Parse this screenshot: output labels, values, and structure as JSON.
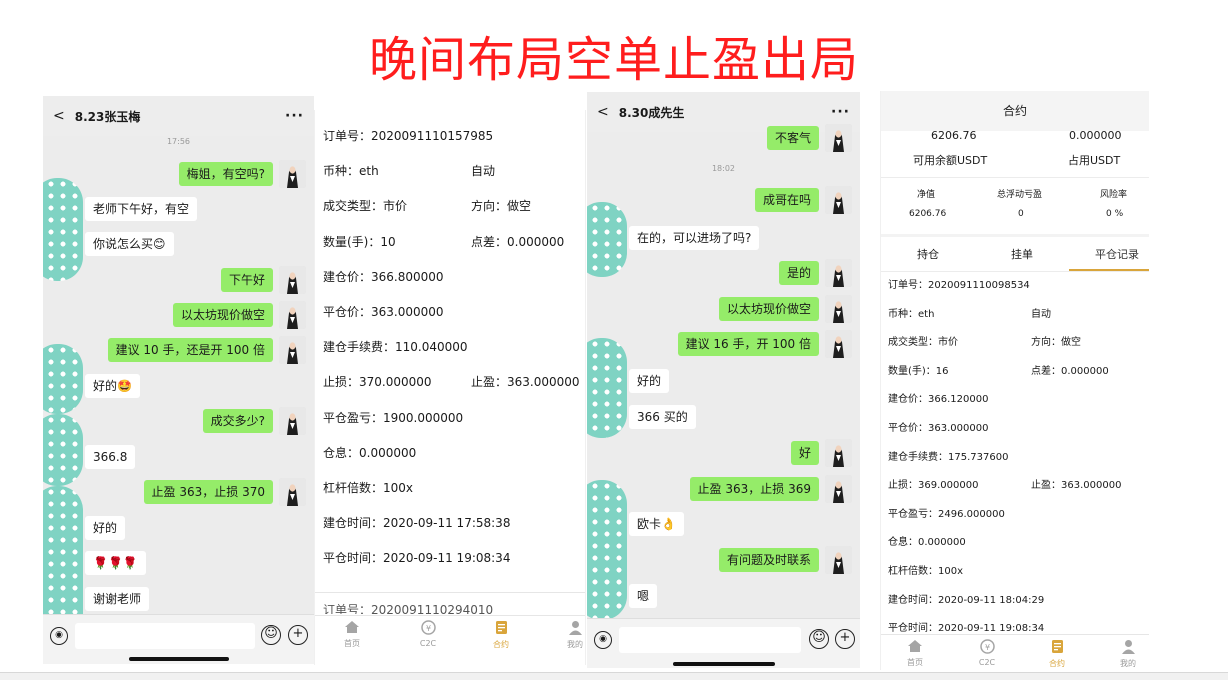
{
  "page_title": "晚间布局空单止盈出局",
  "chat1": {
    "header": {
      "back": "<",
      "name": "8.23张玉梅",
      "more": "···"
    },
    "timestamp": "17:56",
    "messages": [
      {
        "side": "right",
        "text": "梅姐，有空吗?"
      },
      {
        "side": "left",
        "text": "老师下午好，有空"
      },
      {
        "side": "left",
        "text": "你说怎么买😊"
      },
      {
        "side": "right",
        "text": "下午好"
      },
      {
        "side": "right",
        "text": "以太坊现价做空"
      },
      {
        "side": "right",
        "text": "建议 10 手，还是开 100 倍"
      },
      {
        "side": "left",
        "text": "好的🤩"
      },
      {
        "side": "right",
        "text": "成交多少?"
      },
      {
        "side": "left",
        "text": "366.8"
      },
      {
        "side": "right",
        "text": "止盈 363，止损 370"
      },
      {
        "side": "left",
        "text": "好的"
      },
      {
        "side": "left",
        "text": "🌹🌹🌹"
      },
      {
        "side": "left",
        "text": "谢谢老师"
      }
    ]
  },
  "order1": {
    "rows": [
      {
        "l": "订单号：2020091110157985",
        "r": ""
      },
      {
        "l": "币种：eth",
        "r": "自动"
      },
      {
        "l": "成交类型：市价",
        "r": "方向：做空"
      },
      {
        "l": "数量(手)：10",
        "r": "点差：0.000000"
      },
      {
        "l": "建仓价：366.800000",
        "r": ""
      },
      {
        "l": "平仓价：363.000000",
        "r": ""
      },
      {
        "l": "建仓手续费：110.040000",
        "r": ""
      },
      {
        "l": "止损：370.000000",
        "r": "止盈：363.000000"
      },
      {
        "l": "平仓盈亏：1900.000000",
        "r": ""
      },
      {
        "l": "仓息：0.000000",
        "r": ""
      },
      {
        "l": "杠杆倍数：100x",
        "r": ""
      },
      {
        "l": "建仓时间：2020-09-11 17:58:38",
        "r": ""
      },
      {
        "l": "平仓时间：2020-09-11 19:08:34",
        "r": ""
      }
    ],
    "partial_next": "订单号：2020091110294010"
  },
  "tabbar": [
    {
      "icon": "home-icon",
      "label": "首页",
      "active": false
    },
    {
      "icon": "c2c-yen-icon",
      "label": "C2C",
      "active": false
    },
    {
      "icon": "contract-doc-icon",
      "label": "合约",
      "active": true
    },
    {
      "icon": "user-icon",
      "label": "我的",
      "active": false
    }
  ],
  "chat2": {
    "header": {
      "back": "<",
      "name": "8.30成先生",
      "more": "···"
    },
    "timestamp": "18:02",
    "messages": [
      {
        "side": "right",
        "text": "不客气"
      },
      {
        "side": "right",
        "text": "成哥在吗"
      },
      {
        "side": "left",
        "text": "在的，可以进场了吗?"
      },
      {
        "side": "right",
        "text": "是的"
      },
      {
        "side": "right",
        "text": "以太坊现价做空"
      },
      {
        "side": "right",
        "text": "建议 16 手，开 100 倍"
      },
      {
        "side": "left",
        "text": "好的"
      },
      {
        "side": "left",
        "text": "366 买的"
      },
      {
        "side": "right",
        "text": "好"
      },
      {
        "side": "right",
        "text": "止盈 363，止损 369"
      },
      {
        "side": "left",
        "text": "欧卡👌"
      },
      {
        "side": "right",
        "text": "有问题及时联系"
      },
      {
        "side": "left",
        "text": "嗯"
      }
    ]
  },
  "contract": {
    "title": "合约",
    "available_value": "6206.76",
    "available_label": "可用余额USDT",
    "occupied_value": "0.000000",
    "occupied_label": "占用USDT",
    "stats": [
      {
        "label": "净值",
        "value": "6206.76"
      },
      {
        "label": "总浮动亏盈",
        "value": "0"
      },
      {
        "label": "风险率",
        "value": "0 %"
      }
    ],
    "tabs": [
      "持仓",
      "挂单",
      "平仓记录"
    ],
    "active_tab": "平仓记录",
    "rows": [
      {
        "l": "订单号：2020091110098534",
        "r": ""
      },
      {
        "l": "币种：eth",
        "r": "自动"
      },
      {
        "l": "成交类型：市价",
        "r": "方向：做空"
      },
      {
        "l": "数量(手)：16",
        "r": "点差：0.000000"
      },
      {
        "l": "建仓价：366.120000",
        "r": ""
      },
      {
        "l": "平仓价：363.000000",
        "r": ""
      },
      {
        "l": "建仓手续费：175.737600",
        "r": ""
      },
      {
        "l": "止损：369.000000",
        "r": "止盈：363.000000"
      },
      {
        "l": "平仓盈亏：2496.000000",
        "r": ""
      },
      {
        "l": "仓息：0.000000",
        "r": ""
      },
      {
        "l": "杠杆倍数：100x",
        "r": ""
      },
      {
        "l": "建仓时间：2020-09-11 18:04:29",
        "r": ""
      },
      {
        "l": "平仓时间：2020-09-11 19:08:34",
        "r": ""
      }
    ]
  },
  "colors": {
    "title_red": "#ff1d1d",
    "bubble_green": "#95ec69",
    "accent_gold": "#d9a53b",
    "avatar_dots": "#7fd3c3"
  }
}
